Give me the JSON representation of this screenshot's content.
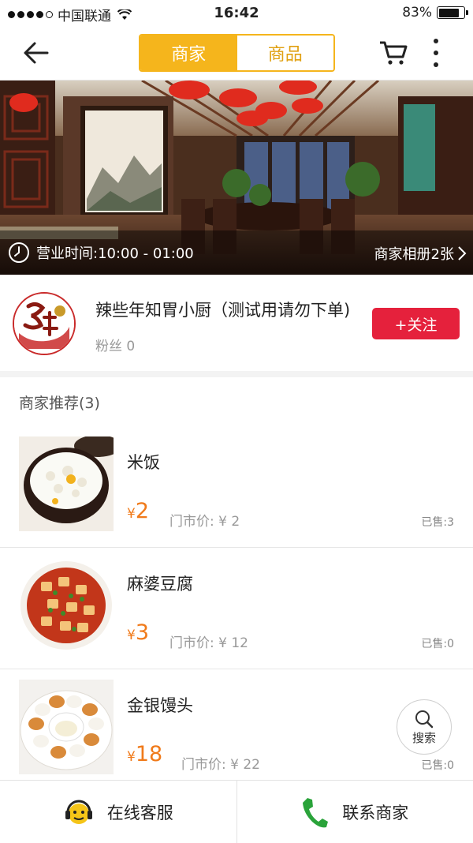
{
  "status_bar": {
    "carrier": "中国联通",
    "time": "16:42",
    "battery": "83%",
    "battery_level": 0.83,
    "signal_bars_filled": 4,
    "signal_bars_total": 5
  },
  "nav": {
    "tabs": [
      {
        "label": "商家",
        "active": true
      },
      {
        "label": "商品",
        "active": false
      }
    ],
    "accent_color": "#f5b51c"
  },
  "banner": {
    "hours": "营业时间:10:00 - 01:00",
    "album": "商家相册2张"
  },
  "merchant": {
    "name": "辣些年知胃小厨（测试用请勿下单)",
    "fans": "粉丝 0",
    "follow_label": "+关注",
    "follow_color": "#e5213c"
  },
  "recommend": {
    "title": "商家推荐(3)",
    "items": [
      {
        "name": "米饭",
        "yen": "¥",
        "price": "2",
        "market": "门市价: ¥ 2",
        "sold": "已售:3",
        "image": "rice-bowl"
      },
      {
        "name": "麻婆豆腐",
        "yen": "¥",
        "price": "3",
        "market": "门市价: ¥ 12",
        "sold": "已售:0",
        "image": "mapo-tofu"
      },
      {
        "name": "金银馒头",
        "yen": "¥",
        "price": "18",
        "market": "门市价: ¥ 22",
        "sold": "已售:0",
        "image": "golden-silver-buns"
      }
    ],
    "price_color": "#f07a1a"
  },
  "fab": {
    "search_label": "搜索"
  },
  "bottom": {
    "service_label": "在线客服",
    "contact_label": "联系商家"
  }
}
